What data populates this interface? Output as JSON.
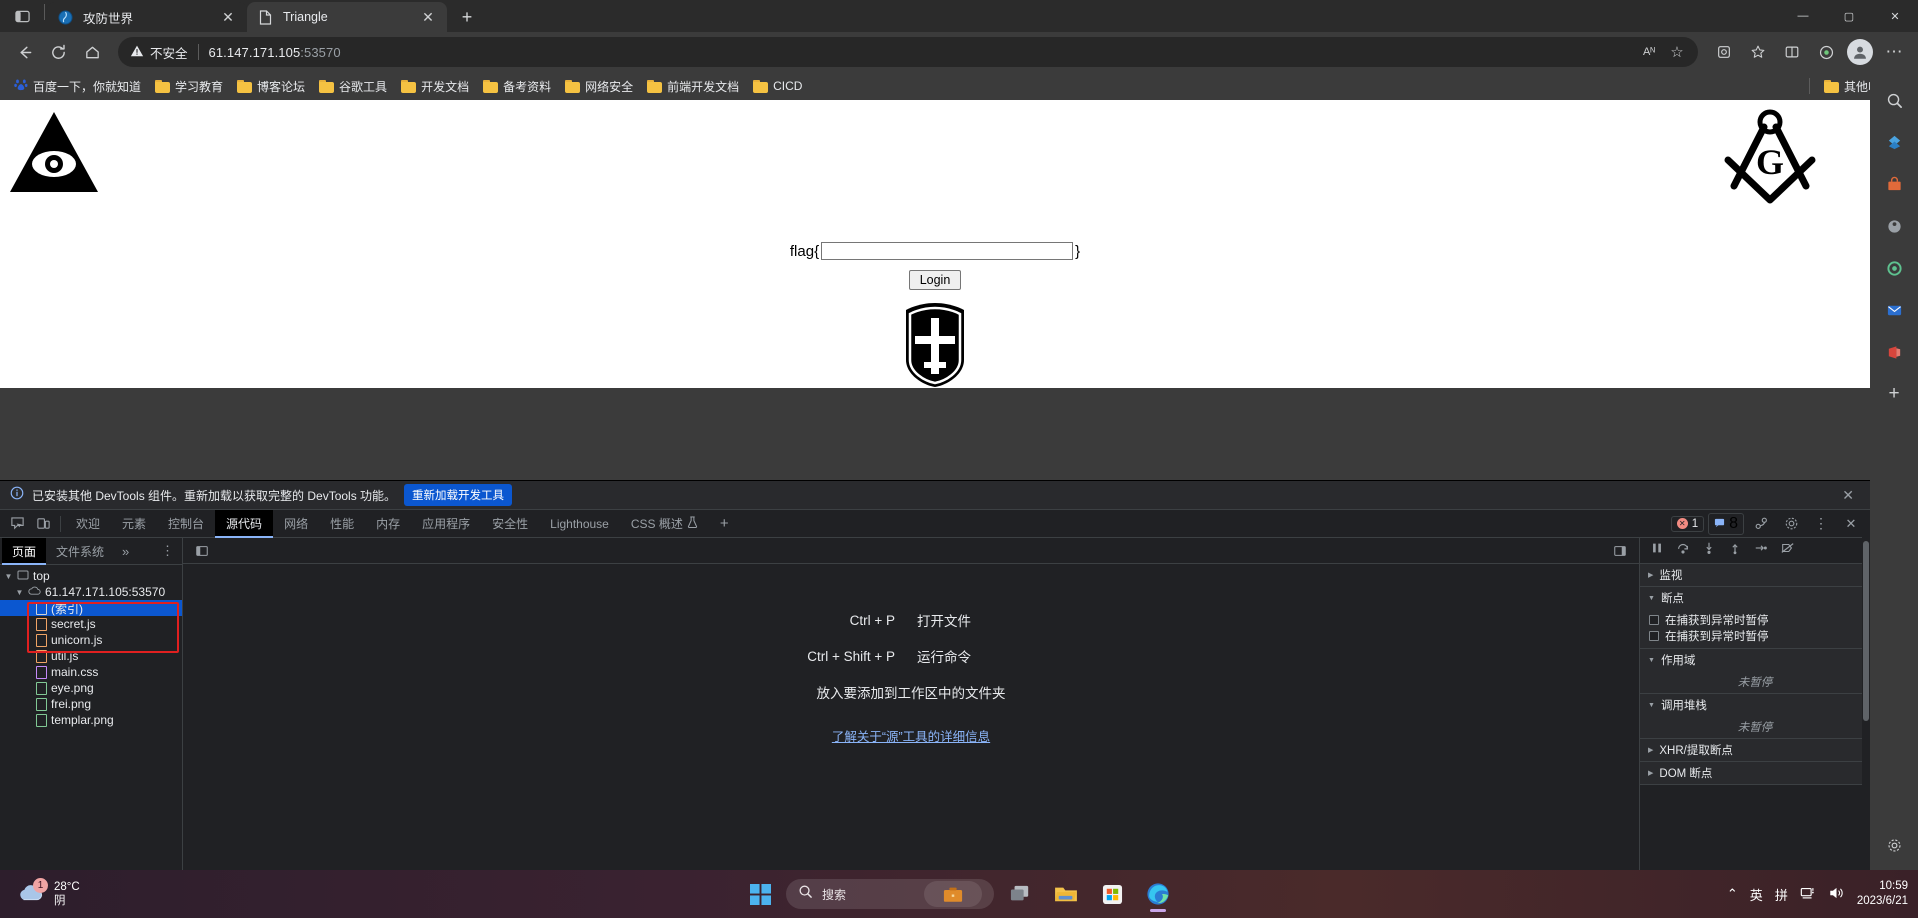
{
  "browser": {
    "tabs": [
      {
        "title": "攻防世界",
        "favicon": "shield-icon",
        "active": false
      },
      {
        "title": "Triangle",
        "favicon": "page-icon",
        "active": true
      }
    ],
    "new_tab_label": "+",
    "window_controls": {
      "minimize": "—",
      "maximize": "▢",
      "close": "✕"
    },
    "toolbar": {
      "back": "←",
      "refresh": "⟳",
      "home": "⌂",
      "security_label": "不安全",
      "url_host": "61.147.171.105",
      "url_port": ":53570",
      "read_aloud": "Aᴺ",
      "favorite_star": "☆",
      "collections": "◔",
      "favorites": "★",
      "split_screen": "◫",
      "browser_essentials": "◎",
      "settings_more": "⋯"
    },
    "bookmarks": [
      {
        "label": "百度一下，你就知道",
        "icon": "baidu-icon"
      },
      {
        "label": "学习教育",
        "icon": "folder-icon"
      },
      {
        "label": "博客论坛",
        "icon": "folder-icon"
      },
      {
        "label": "谷歌工具",
        "icon": "folder-icon"
      },
      {
        "label": "开发文档",
        "icon": "folder-icon"
      },
      {
        "label": "备考资料",
        "icon": "folder-icon"
      },
      {
        "label": "网络安全",
        "icon": "folder-icon"
      },
      {
        "label": "前端开发文档",
        "icon": "folder-icon"
      },
      {
        "label": "CICD",
        "icon": "folder-icon"
      }
    ],
    "other_favorites": {
      "label": "其他收藏夹",
      "icon": "folder-icon"
    }
  },
  "page": {
    "flag_prefix": "flag{",
    "flag_suffix": "}",
    "input_value": "",
    "input_placeholder": "",
    "login_label": "Login",
    "images": [
      {
        "name": "eye.png",
        "alt": "all-seeing-eye-triangle"
      },
      {
        "name": "frei.png",
        "alt": "masonic-square-compass-G"
      },
      {
        "name": "templar.png",
        "alt": "templar-cross-shield"
      }
    ]
  },
  "devtools": {
    "banner": {
      "text": "已安装其他 DevTools 组件。重新加载以获取完整的 DevTools 功能。",
      "reload_label": "重新加载开发工具",
      "close": "✕"
    },
    "tabs": [
      {
        "label": "欢迎",
        "active": false
      },
      {
        "label": "元素",
        "active": false
      },
      {
        "label": "控制台",
        "active": false
      },
      {
        "label": "源代码",
        "active": true
      },
      {
        "label": "网络",
        "active": false
      },
      {
        "label": "性能",
        "active": false
      },
      {
        "label": "内存",
        "active": false
      },
      {
        "label": "应用程序",
        "active": false
      },
      {
        "label": "安全性",
        "active": false
      },
      {
        "label": "Lighthouse",
        "active": false
      },
      {
        "label": "CSS 概述",
        "active": false,
        "beaker": true
      }
    ],
    "add_tab": "+",
    "badges": {
      "errors": "1",
      "messages": "8"
    },
    "toolbar_right": {
      "devices": "⎔",
      "settings": "⚙",
      "more": "⋮",
      "close": "✕"
    },
    "navigator": {
      "tabs": [
        {
          "label": "页面",
          "active": true
        },
        {
          "label": "文件系统",
          "active": false
        }
      ],
      "more": "»",
      "kebab": "⋮",
      "tree": [
        {
          "label": "top",
          "depth": 0,
          "icon": "frame-icon",
          "twisty": "▼",
          "selected": false
        },
        {
          "label": "61.147.171.105:53570",
          "depth": 1,
          "icon": "cloud-icon",
          "twisty": "▼",
          "selected": false
        },
        {
          "label": "(索引)",
          "depth": 2,
          "icon": "doc-icon",
          "selected": true,
          "color": "#e8eaed"
        },
        {
          "label": "secret.js",
          "depth": 2,
          "icon": "js-icon",
          "selected": false,
          "color": "#f0a465"
        },
        {
          "label": "unicorn.js",
          "depth": 2,
          "icon": "js-icon",
          "selected": false,
          "color": "#f0a465"
        },
        {
          "label": "util.js",
          "depth": 2,
          "icon": "js-icon",
          "selected": false,
          "color": "#f0a465"
        },
        {
          "label": "main.css",
          "depth": 2,
          "icon": "css-icon",
          "selected": false,
          "color": "#c58af9"
        },
        {
          "label": "eye.png",
          "depth": 2,
          "icon": "img-icon",
          "selected": false,
          "color": "#81c995"
        },
        {
          "label": "frei.png",
          "depth": 2,
          "icon": "img-icon",
          "selected": false,
          "color": "#81c995"
        },
        {
          "label": "templar.png",
          "depth": 2,
          "icon": "img-icon",
          "selected": false,
          "color": "#81c995"
        }
      ],
      "highlight_color": "#e02020"
    },
    "editor_hints": {
      "rows": [
        {
          "key": "Ctrl + P",
          "value": "打开文件"
        },
        {
          "key": "Ctrl + Shift + P",
          "value": "运行命令"
        }
      ],
      "drop_hint": "放入要添加到工作区中的文件夹",
      "link": "了解关于“源”工具的详细信息"
    },
    "debugger": {
      "controls": [
        "pause-resume",
        "step-over",
        "step-into",
        "step-out",
        "step",
        "deactivate-breakpoints"
      ],
      "sections": [
        {
          "title": "监视",
          "caret": "▶",
          "expanded": false
        },
        {
          "title": "断点",
          "caret": "▼",
          "expanded": true
        },
        {
          "title": "作用域",
          "caret": "▼",
          "expanded": true
        },
        {
          "title": "调用堆栈",
          "caret": "▼",
          "expanded": true
        },
        {
          "title": "XHR/提取断点",
          "caret": "▶",
          "expanded": false
        },
        {
          "title": "DOM 断点",
          "caret": "▶",
          "expanded": false
        }
      ],
      "breakpoint_checkboxes": [
        "在捕获到异常时暂停",
        "在捕获到异常时暂停"
      ],
      "scope_empty": "未暂停",
      "callstack_empty": "未暂停"
    }
  },
  "taskbar": {
    "weather": {
      "temp": "28°C",
      "condition": "阴",
      "badge": "1"
    },
    "start": "start-icon",
    "search_placeholder": "搜索",
    "apps": [
      "widgets-icon",
      "task-view-icon",
      "file-explorer-icon",
      "microsoft-store-icon",
      "edge-icon"
    ],
    "tray": {
      "chevron": "⌃",
      "ime_lang": "英",
      "ime_mode": "拼",
      "network": "network-icon",
      "volume": "volume-icon"
    },
    "clock": {
      "time": "10:59",
      "date": "2023/6/21"
    }
  }
}
